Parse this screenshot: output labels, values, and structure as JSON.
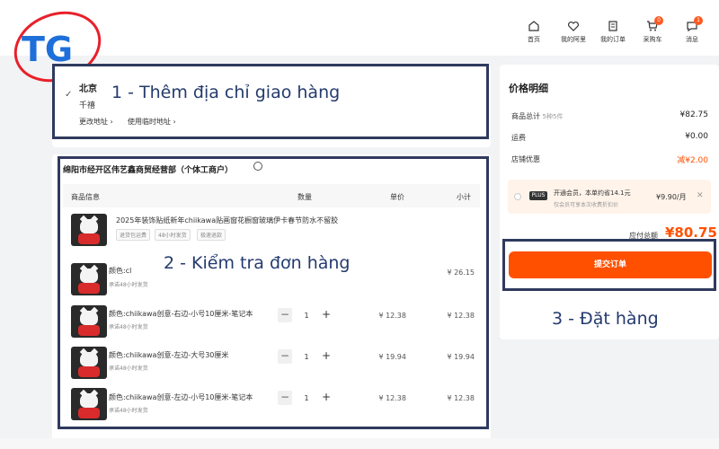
{
  "brand": {
    "logo_text": "TG",
    "colors": {
      "blue": "#1e6fd9",
      "red": "#e8202a"
    }
  },
  "nav": [
    {
      "label": "首页",
      "icon": "home-icon"
    },
    {
      "label": "我的阿里",
      "icon": "heart-icon"
    },
    {
      "label": "我的订单",
      "icon": "order-icon"
    },
    {
      "label": "采购车",
      "icon": "cart-icon",
      "badge": "0"
    },
    {
      "label": "消息",
      "icon": "message-icon",
      "badge": "1"
    }
  ],
  "address": {
    "city": "北京",
    "name": "千禧",
    "change_label": "更改地址",
    "temp_label": "使用临时地址"
  },
  "annotations": {
    "step1": "1 - Thêm địa chỉ giao hàng",
    "step2": "2 - Kiểm tra đơn hàng",
    "step3": "3 - Đặt hàng"
  },
  "shop": {
    "name": "绵阳市经开区伟艺鑫商贸经营部（个体工商户）"
  },
  "table": {
    "headers": [
      "商品信息",
      "数量",
      "单价",
      "小计"
    ]
  },
  "products": {
    "title": "2025年装饰贴纸新年chiikawa贴画窗花橱窗玻璃伊卡春节防水不留胶",
    "tags": [
      "退货包运费",
      "48小时发货",
      "极速退款"
    ],
    "items": [
      {
        "variant": "颜色:cl",
        "ship": "承诺48小时发货",
        "qty": "",
        "unit": "",
        "subtotal": "¥ 26.15"
      },
      {
        "variant": "颜色:chiikawa创意-右边-小号10厘米-笔记本",
        "ship": "承诺48小时发货",
        "qty": "1",
        "unit": "¥ 12.38",
        "subtotal": "¥ 12.38"
      },
      {
        "variant": "颜色:chiikawa创意-左边-大号30厘米",
        "ship": "承诺48小时发货",
        "qty": "1",
        "unit": "¥ 19.94",
        "subtotal": "¥ 19.94"
      },
      {
        "variant": "颜色:chiikawa创意-左边-小号10厘米-笔记本",
        "ship": "承诺48小时发货",
        "qty": "1",
        "unit": "¥ 12.38",
        "subtotal": "¥ 12.38"
      }
    ]
  },
  "summary": {
    "title": "价格明细",
    "goods_label": "商品总计",
    "goods_meta": "5种5件",
    "goods_value": "¥82.75",
    "shipping_label": "运费",
    "shipping_value": "¥0.00",
    "discount_label": "店铺优惠",
    "discount_value": "减¥2.00",
    "member_badge": "PLUS",
    "member_text": "开通会员，本单约省14.1元",
    "member_sub": "仅会员可享本次收费折扣价",
    "member_price": "¥9.90/月",
    "total_label": "应付总额",
    "total_value": "¥80.75",
    "submit_label": "提交订单"
  }
}
